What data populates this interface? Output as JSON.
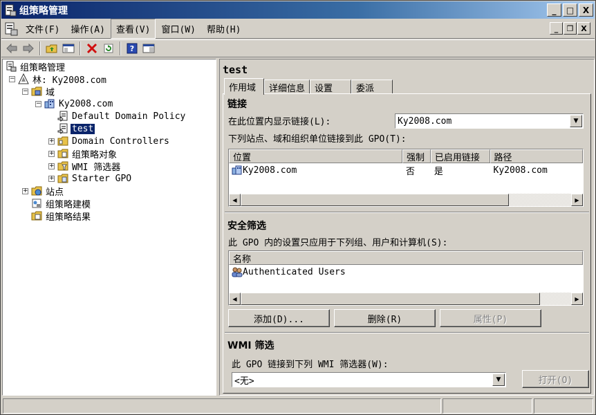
{
  "window": {
    "title": "组策略管理",
    "minimize": "_",
    "maximize": "□",
    "close": "X"
  },
  "menu": {
    "items": [
      "文件(F)",
      "操作(A)",
      "查看(V)",
      "窗口(W)",
      "帮助(H)"
    ],
    "active_index": 2
  },
  "child_controls": {
    "minimize": "_",
    "restore": "❐",
    "close": "X"
  },
  "tree": {
    "root": "组策略管理",
    "forest": "林: Ky2008.com",
    "domains": "域",
    "domain": "Ky2008.com",
    "gpo_default": "Default Domain Policy",
    "gpo_test": "test",
    "dc": "Domain Controllers",
    "gpo_objects": "组策略对象",
    "wmi_filters": "WMI 筛选器",
    "starter_gpo": "Starter GPO",
    "sites": "站点",
    "modeling": "组策略建模",
    "results": "组策略结果"
  },
  "detail": {
    "gpo_name": "test",
    "tabs": [
      "作用域",
      "详细信息",
      "设置",
      "委派"
    ],
    "active_tab": 0,
    "links": {
      "heading": "链接",
      "location_label": "在此位置内显示链接(L):",
      "location_value": "Ky2008.com",
      "list_label": "下列站点、域和组织单位链接到此 GPO(T):",
      "columns": [
        "位置",
        "强制",
        "已启用链接",
        "路径"
      ],
      "rows": [
        {
          "location": "Ky2008.com",
          "enforced": "否",
          "enabled": "是",
          "path": "Ky2008.com"
        }
      ]
    },
    "security": {
      "heading": "安全筛选",
      "description": "此 GPO 内的设置只应用于下列组、用户和计算机(S):",
      "columns": [
        "名称"
      ],
      "rows": [
        "Authenticated Users"
      ],
      "add_button": "添加(D)...",
      "remove_button": "删除(R)",
      "properties_button": "属性(P)"
    },
    "wmi": {
      "heading": "WMI 筛选",
      "description": "此 GPO 链接到下列 WMI 筛选器(W):",
      "value": "<无>",
      "open_button": "打开(O)"
    }
  },
  "scroll": {
    "left": "◀",
    "right": "▶",
    "expand": "+",
    "collapse": "−",
    "dropdown": "▼"
  },
  "colors": {
    "title_start": "#0a246a",
    "title_end": "#a6caf0",
    "selection": "#0a246a",
    "face": "#d4d0c8"
  }
}
